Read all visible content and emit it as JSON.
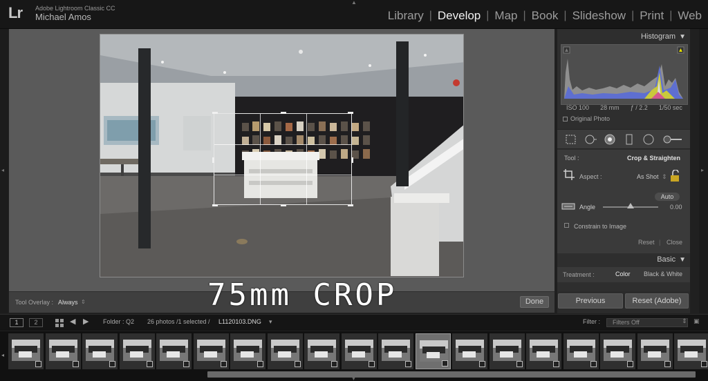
{
  "app": {
    "logo": "Lr",
    "name": "Adobe Lightroom Classic CC",
    "user": "Michael Amos"
  },
  "modules": [
    "Library",
    "Develop",
    "Map",
    "Book",
    "Slideshow",
    "Print",
    "Web"
  ],
  "active_module": "Develop",
  "toolbar": {
    "overlay_label": "Tool Overlay :",
    "overlay_value": "Always",
    "done_label": "Done"
  },
  "caption": "75mm CROP",
  "histogram": {
    "title": "Histogram",
    "iso": "ISO 100",
    "focal": "28 mm",
    "aperture": "ƒ / 2.2",
    "shutter": "1/50 sec",
    "original_photo": "Original Photo"
  },
  "crop_panel": {
    "tool_label": "Tool :",
    "tool_value": "Crop & Straighten",
    "aspect_label": "Aspect :",
    "aspect_value": "As Shot",
    "auto_label": "Auto",
    "angle_label": "Angle",
    "angle_value": "0.00",
    "angle_fraction": 0.5,
    "constrain_label": "Constrain to Image",
    "reset_label": "Reset",
    "close_label": "Close"
  },
  "basic_panel": {
    "title": "Basic",
    "treatment_label": "Treatment :",
    "color_label": "Color",
    "bw_label": "Black & White"
  },
  "panel_buttons": {
    "previous": "Previous",
    "reset": "Reset (Adobe)"
  },
  "filmbar": {
    "view1": "1",
    "view2": "2",
    "folder_label": "Folder : Q2",
    "count_text": "26 photos /1 selected /",
    "filename": "L1120103.DNG",
    "filter_label": "Filter :",
    "filter_value": "Filters Off"
  },
  "icons": {
    "back": "arrow-left-icon",
    "forward": "arrow-right-icon",
    "grid": "grid-view-icon"
  },
  "thumbnails": [
    {
      "id": 1
    },
    {
      "id": 2
    },
    {
      "id": 3
    },
    {
      "id": 4
    },
    {
      "id": 5
    },
    {
      "id": 6
    },
    {
      "id": 7
    },
    {
      "id": 8
    },
    {
      "id": 9
    },
    {
      "id": 10
    },
    {
      "id": 11
    },
    {
      "id": 12,
      "selected": true
    },
    {
      "id": 13
    },
    {
      "id": 14
    },
    {
      "id": 15
    },
    {
      "id": 16
    },
    {
      "id": 17
    },
    {
      "id": 18
    },
    {
      "id": 19
    }
  ]
}
